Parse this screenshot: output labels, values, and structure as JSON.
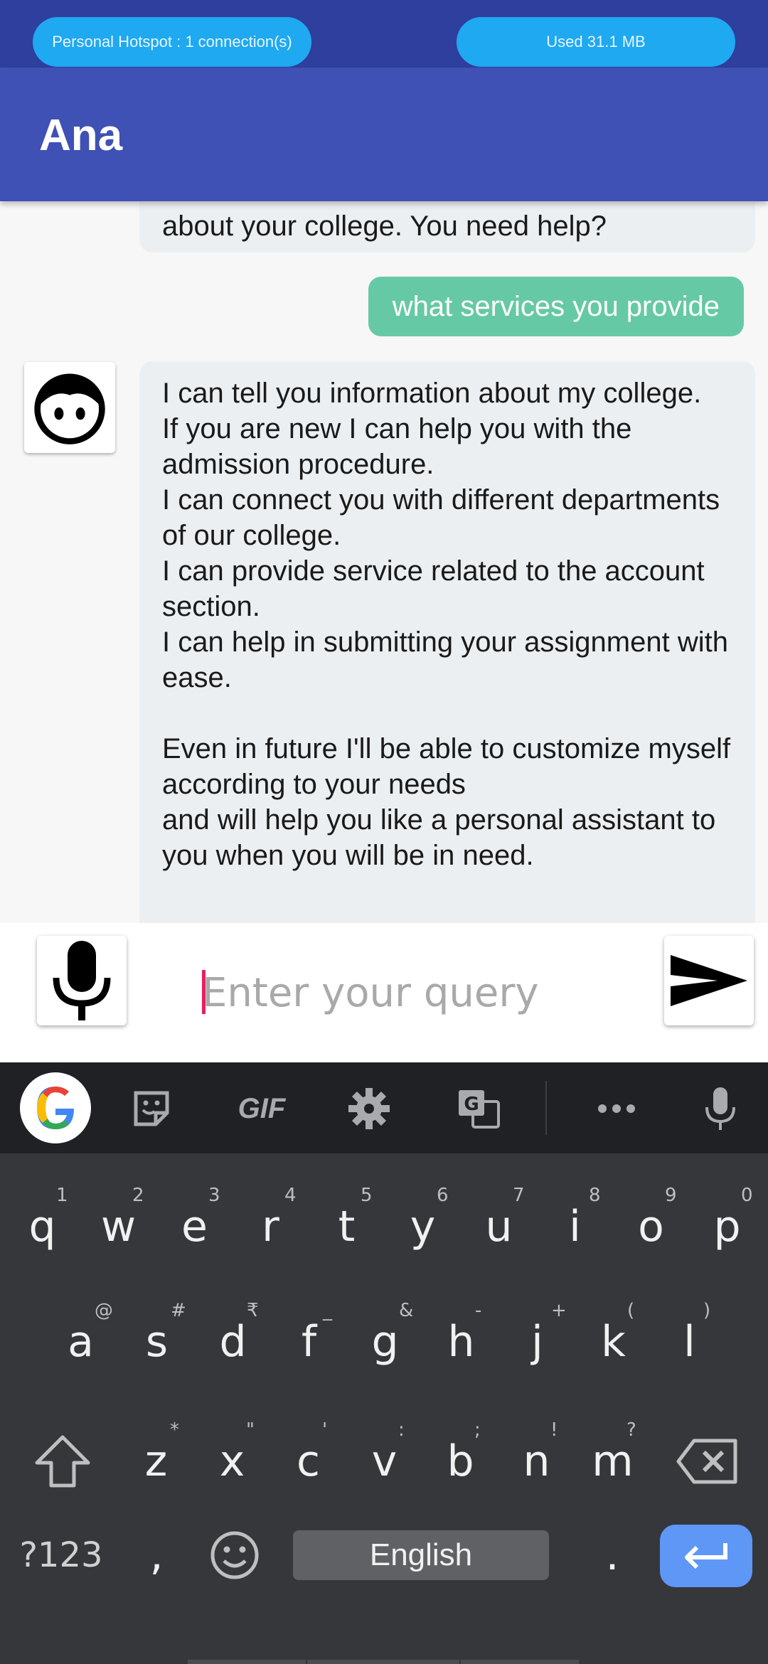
{
  "status_bar": {
    "hotspot": "Personal Hotspot : 1 connection(s)",
    "data_used": "Used  31.1 MB"
  },
  "app_bar": {
    "title": "Ana"
  },
  "chat": {
    "partial_bot_message": "about your college. You need  help?",
    "user_message": "what services you provide",
    "bot_message": "I can tell you information about my college.\nIf you are new I can help you with the admission procedure.\nI can connect you with different departments of our college.\nI can provide service related to the account section.\nI can help in submitting your assignment with ease.\n\nEven in future I'll be able to customize myself according to your needs\nand will help you like a personal assistant to you when you will be in need.",
    "avatar_icon": "boy-face-icon"
  },
  "input": {
    "placeholder": "Enter your query",
    "value": "",
    "mic_icon": "microphone-icon",
    "send_icon": "send-icon"
  },
  "keyboard": {
    "toolbar": {
      "items": [
        "google-icon",
        "sticker-icon",
        "GIF",
        "gear-icon",
        "translate-icon",
        "more-icon",
        "voice-mic-icon"
      ],
      "gif_label": "GIF"
    },
    "row1": [
      {
        "key": "q",
        "hint": "1"
      },
      {
        "key": "w",
        "hint": "2"
      },
      {
        "key": "e",
        "hint": "3"
      },
      {
        "key": "r",
        "hint": "4"
      },
      {
        "key": "t",
        "hint": "5"
      },
      {
        "key": "y",
        "hint": "6"
      },
      {
        "key": "u",
        "hint": "7"
      },
      {
        "key": "i",
        "hint": "8"
      },
      {
        "key": "o",
        "hint": "9"
      },
      {
        "key": "p",
        "hint": "0"
      }
    ],
    "row2": [
      {
        "key": "a",
        "hint": "@"
      },
      {
        "key": "s",
        "hint": "#"
      },
      {
        "key": "d",
        "hint": "₹"
      },
      {
        "key": "f",
        "hint": "_"
      },
      {
        "key": "g",
        "hint": "&"
      },
      {
        "key": "h",
        "hint": "-"
      },
      {
        "key": "j",
        "hint": "+"
      },
      {
        "key": "k",
        "hint": "("
      },
      {
        "key": "l",
        "hint": ")"
      }
    ],
    "row3": [
      {
        "key": "z",
        "hint": "*"
      },
      {
        "key": "x",
        "hint": "\""
      },
      {
        "key": "c",
        "hint": "'"
      },
      {
        "key": "v",
        "hint": ":"
      },
      {
        "key": "b",
        "hint": ";"
      },
      {
        "key": "n",
        "hint": "!"
      },
      {
        "key": "m",
        "hint": "?"
      }
    ],
    "symbols_key": "?123",
    "comma_key": ",",
    "space_label": "English",
    "period_key": ".",
    "colors": {
      "enter": "#5e97f6",
      "background": "#35373b"
    }
  }
}
